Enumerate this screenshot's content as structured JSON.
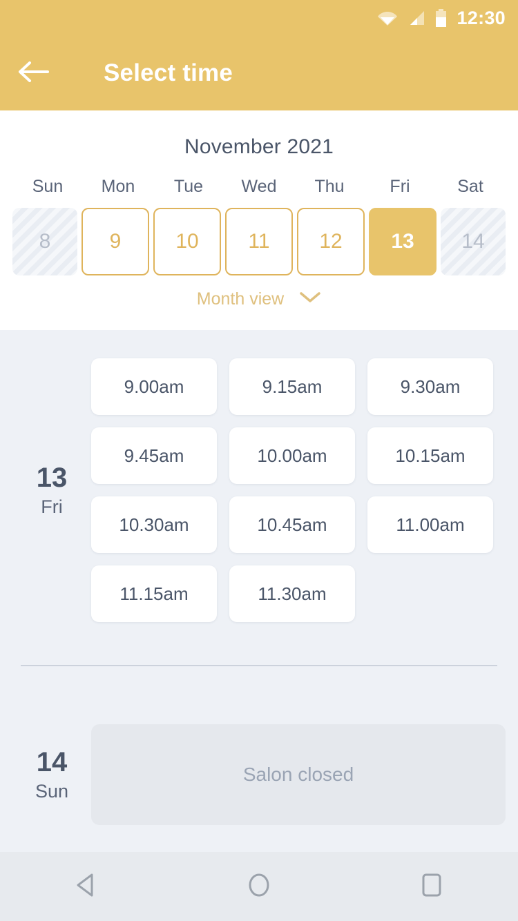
{
  "status_bar": {
    "time": "12:30",
    "icons": [
      "wifi-icon",
      "cellular-signal-icon",
      "battery-icon"
    ]
  },
  "app_bar": {
    "back_icon": "arrow-left-icon",
    "title": "Select time"
  },
  "calendar": {
    "month_title": "November 2021",
    "weekday_headers": [
      "Sun",
      "Mon",
      "Tue",
      "Wed",
      "Thu",
      "Fri",
      "Sat"
    ],
    "days": [
      {
        "number": "8",
        "state": "disabled"
      },
      {
        "number": "9",
        "state": "available"
      },
      {
        "number": "10",
        "state": "available"
      },
      {
        "number": "11",
        "state": "available"
      },
      {
        "number": "12",
        "state": "available"
      },
      {
        "number": "13",
        "state": "selected"
      },
      {
        "number": "14",
        "state": "disabled"
      }
    ],
    "month_view_label": "Month view",
    "month_view_icon": "chevron-down-icon"
  },
  "day_groups": [
    {
      "day_number": "13",
      "day_name": "Fri",
      "slots": [
        "9.00am",
        "9.15am",
        "9.30am",
        "9.45am",
        "10.00am",
        "10.15am",
        "10.30am",
        "10.45am",
        "11.00am",
        "11.15am",
        "11.30am"
      ]
    },
    {
      "day_number": "14",
      "day_name": "Sun",
      "closed_message": "Salon closed"
    }
  ],
  "nav_bar": {
    "back_icon": "nav-back-triangle-icon",
    "home_icon": "nav-home-circle-icon",
    "recents_icon": "nav-recents-square-icon"
  },
  "colors": {
    "accent_gold": "#e8c46b",
    "accent_gold_border": "#dfb45c",
    "header_text": "#ffffff",
    "content_bg": "#eef1f6",
    "slot_bg": "#ffffff",
    "text_dark": "#4a5568",
    "text_muted": "#9aa4b4",
    "disabled_bg": "#e9edf3",
    "closed_card_bg": "#e5e8ed",
    "nav_bar_bg": "#e7eaee"
  }
}
